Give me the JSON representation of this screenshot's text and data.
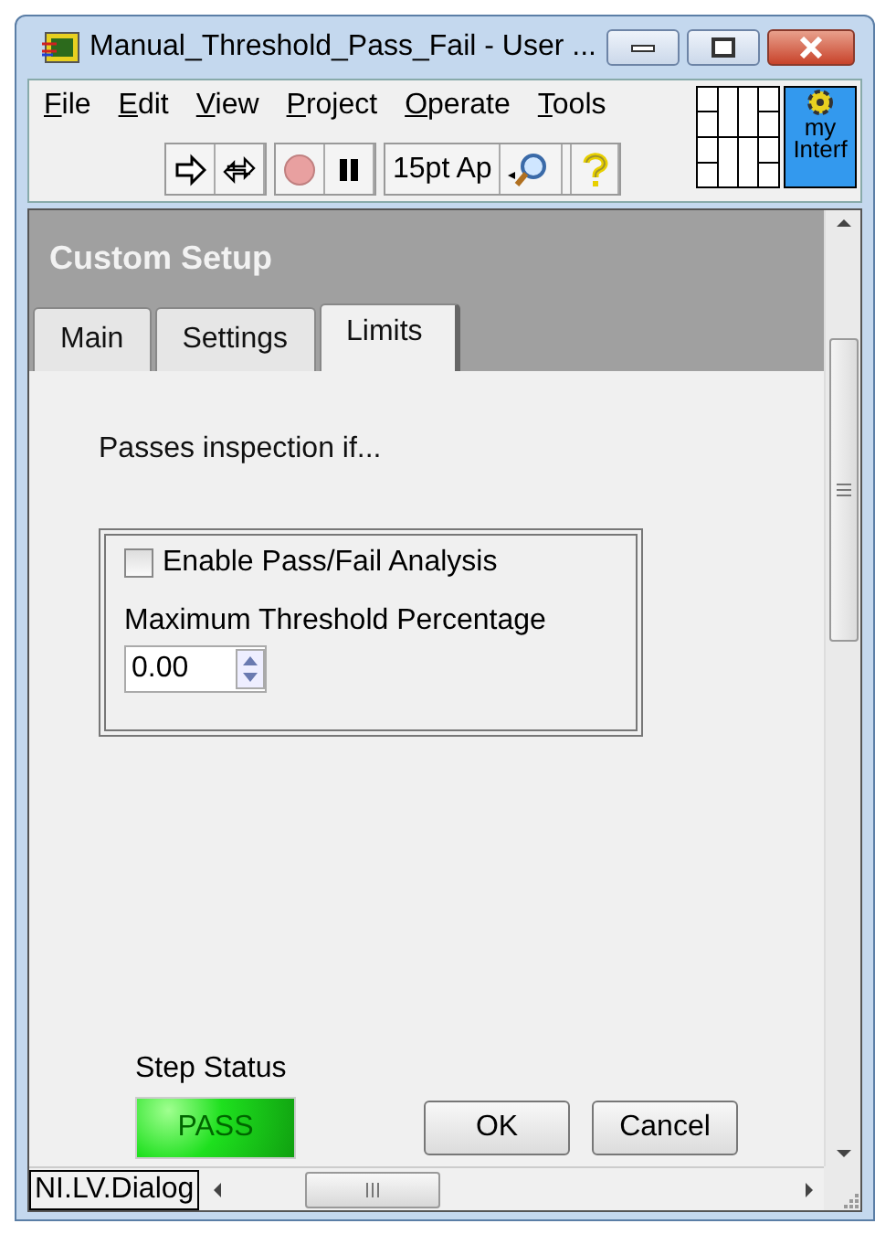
{
  "window": {
    "title": "Manual_Threshold_Pass_Fail  - User ..."
  },
  "menu": [
    {
      "label": "File"
    },
    {
      "label": "Edit"
    },
    {
      "label": "View"
    },
    {
      "label": "Project"
    },
    {
      "label": "Operate"
    },
    {
      "label": "Tools"
    }
  ],
  "toolbar": {
    "font_menu": "15pt Ap"
  },
  "vi_icon": {
    "lines": [
      "my",
      "Interf"
    ]
  },
  "panel": {
    "title": "Custom Setup",
    "tabs": [
      {
        "label": "Main",
        "selected": false
      },
      {
        "label": "Settings",
        "selected": false
      },
      {
        "label": "Limits",
        "selected": true
      }
    ],
    "prompt": "Passes inspection if...",
    "enable_checkbox": {
      "label": "Enable Pass/Fail Analysis",
      "checked": false
    },
    "threshold": {
      "label": "Maximum Threshold Percentage",
      "value": "0.00"
    },
    "step_status": {
      "label": "Step Status",
      "value": "PASS",
      "on": true
    },
    "buttons": [
      "OK",
      "Cancel"
    ]
  },
  "status_label": "NI.LV.Dialog"
}
